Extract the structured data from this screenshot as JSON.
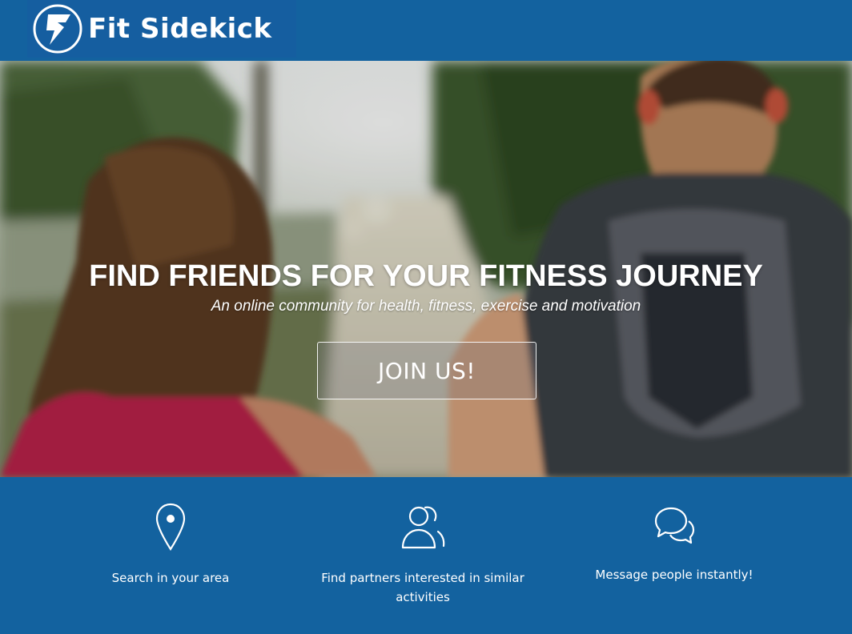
{
  "brand": {
    "name": "Fit Sidekick",
    "logo_icon": "lightning-bolt-logo-icon",
    "color": "#13629f"
  },
  "hero": {
    "title": "FIND FRIENDS FOR YOUR FITNESS JOURNEY",
    "subtitle": "An online community for health, fitness, exercise and motivation",
    "cta_label": "JOIN US!"
  },
  "features": [
    {
      "icon": "map-pin-icon",
      "label": "Search in your area"
    },
    {
      "icon": "users-icon",
      "label": "Find partners interested in similar activities"
    },
    {
      "icon": "chat-bubbles-icon",
      "label": "Message people instantly!"
    }
  ]
}
